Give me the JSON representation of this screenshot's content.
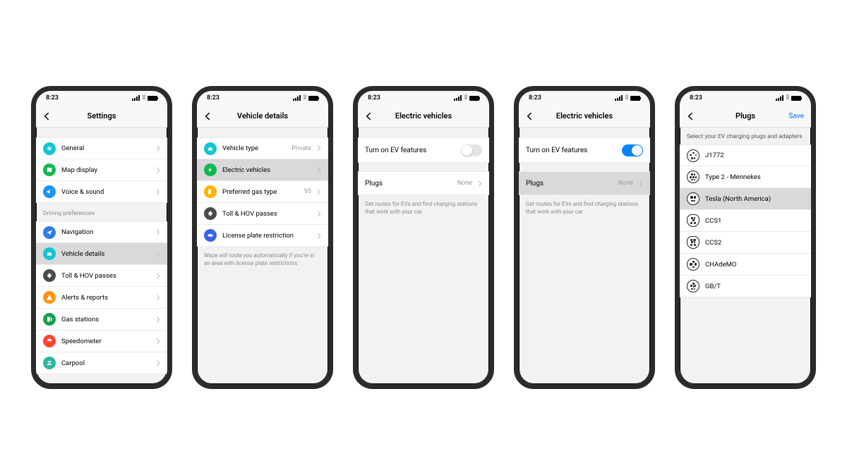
{
  "status": {
    "time": "8:23"
  },
  "colors": {
    "cyan": "#15c4d3",
    "green": "#0fb74d",
    "greenDark": "#1aa04c",
    "blue": "#1a94f0",
    "blueDark": "#2b7de0",
    "gray": "#4b4b4f",
    "orange": "#ff9412",
    "yellow": "#ffb300",
    "red": "#ff4631",
    "teal": "#2bb79a",
    "indigo": "#3a64e8"
  },
  "screens": [
    {
      "id": "settings",
      "title": "Settings",
      "groups": [
        {
          "items": [
            {
              "icon": "gear-icon",
              "color": "cyan",
              "label": "General"
            },
            {
              "icon": "map-icon",
              "color": "green",
              "label": "Map display"
            },
            {
              "icon": "speaker-icon",
              "color": "blue",
              "label": "Voice & sound"
            }
          ]
        },
        {
          "header": "Driving preferences",
          "items": [
            {
              "icon": "nav-arrow-icon",
              "color": "blueDark",
              "label": "Navigation"
            },
            {
              "icon": "car-icon",
              "color": "cyan",
              "label": "Vehicle details",
              "selected": true
            },
            {
              "icon": "diamond-icon",
              "color": "gray",
              "label": "Toll & HOV passes"
            },
            {
              "icon": "alert-icon",
              "color": "orange",
              "label": "Alerts & reports"
            },
            {
              "icon": "fuel-icon",
              "color": "greenDark",
              "label": "Gas stations"
            },
            {
              "icon": "speedo-icon",
              "color": "red",
              "label": "Speedometer"
            },
            {
              "icon": "carpool-icon",
              "color": "teal",
              "label": "Carpool"
            }
          ]
        }
      ]
    },
    {
      "id": "vehicle-details",
      "title": "Vehicle details",
      "groups": [
        {
          "items": [
            {
              "icon": "car-icon",
              "color": "cyan",
              "label": "Vehicle type",
              "value": "Private"
            },
            {
              "icon": "ev-icon",
              "color": "green",
              "label": "Electric vehicles",
              "selected": true
            },
            {
              "icon": "fuel-icon",
              "color": "yellow",
              "label": "Preferred gas type",
              "value": "95"
            },
            {
              "icon": "diamond-icon",
              "color": "gray",
              "label": "Toll & HOV passes"
            },
            {
              "icon": "plate-icon",
              "color": "indigo",
              "label": "License plate restriction"
            }
          ]
        }
      ],
      "footer": "Waze will route you automatically if you're in an area with license plate restrictions"
    },
    {
      "id": "ev-off",
      "title": "Electric vehicles",
      "toggle": {
        "label": "Turn on EV features",
        "state": "off"
      },
      "plugs": {
        "label": "Plugs",
        "value": "None"
      },
      "note": "Get routes for EVs and find charging stations that work with your car"
    },
    {
      "id": "ev-on",
      "title": "Electric vehicles",
      "toggle": {
        "label": "Turn on EV features",
        "state": "on"
      },
      "plugs": {
        "label": "Plugs",
        "value": "None",
        "selected": true
      },
      "note": "Get routes for EVs and find charging stations that work with your car"
    },
    {
      "id": "plugs",
      "title": "Plugs",
      "save": "Save",
      "info": "Select your EV charging plugs and adapters",
      "items": [
        {
          "label": "J1772",
          "dots": "j1772"
        },
        {
          "label": "Type 2 - Mennekes",
          "dots": "type2"
        },
        {
          "label": "Tesla (North America)",
          "dots": "tesla",
          "selected": true
        },
        {
          "label": "CCS1",
          "dots": "ccs1"
        },
        {
          "label": "CCS2",
          "dots": "ccs2"
        },
        {
          "label": "CHAdeMO",
          "dots": "chademo"
        },
        {
          "label": "GB/T",
          "dots": "gbt"
        }
      ]
    }
  ]
}
